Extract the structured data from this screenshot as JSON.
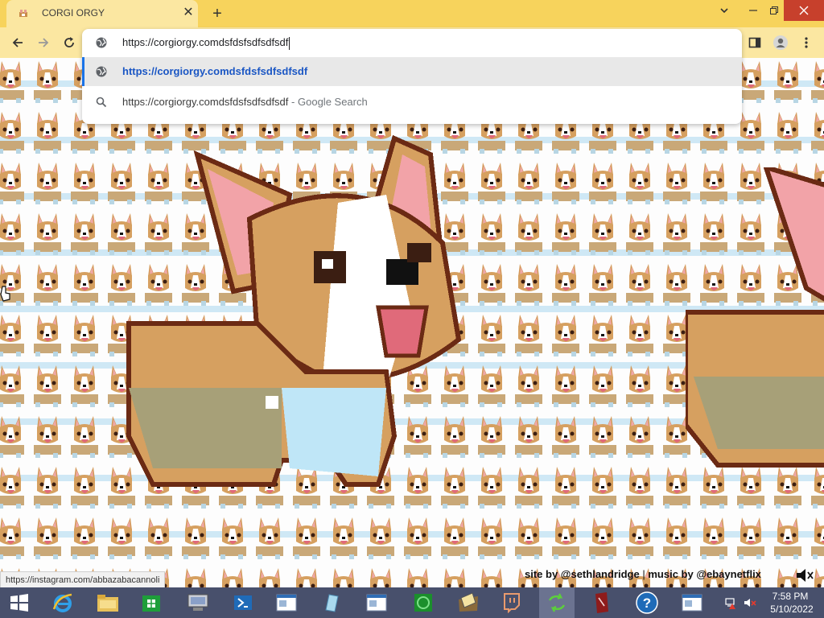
{
  "browser": {
    "tab_title": "CORGI ORGY",
    "tab_close_glyph": "✕",
    "new_tab_glyph": "+",
    "accent_color": "#f7d35c"
  },
  "omnibox": {
    "input_value": "https://corgiorgy.comdsfdsfsdfsdfsdf",
    "suggestions": [
      {
        "icon": "globe-icon",
        "text": "https://corgiorgy.comdsfdsfsdfsdfsdf"
      },
      {
        "icon": "search-icon",
        "text": "https://corgiorgy.comdsfdsfsdfsdfsdf",
        "suffix_sep": "-",
        "suffix": "Google Search"
      }
    ]
  },
  "page": {
    "status_url": "https://instagram.com/abbazabacannoli",
    "credits": {
      "site": "site by @sethlandridge",
      "separator": "|",
      "music": "music by @ebaynetflix"
    }
  },
  "taskbar": {
    "apps": [
      "start-icon",
      "internet-explorer-icon",
      "file-explorer-icon",
      "store-icon",
      "network-icon",
      "powershell-icon",
      "window-icon",
      "notes-icon",
      "window-icon",
      "clock-app-icon",
      "folder-icon",
      "twitch-icon",
      "sync-icon",
      "book-icon",
      "help-icon",
      "window-icon"
    ],
    "time": "7:58 PM",
    "date": "5/10/2022"
  }
}
